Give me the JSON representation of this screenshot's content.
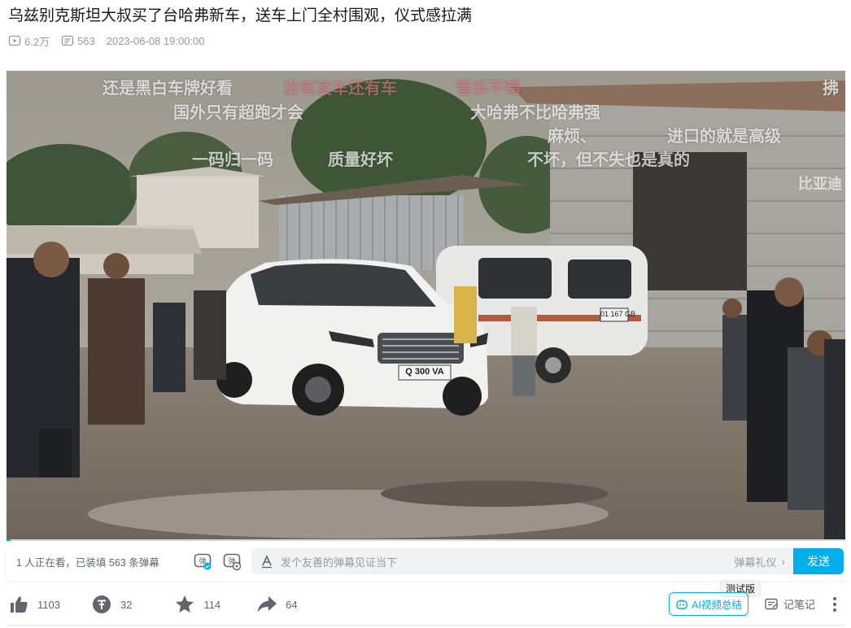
{
  "video": {
    "title": "乌兹别克斯坦大叔买了台哈弗新车，送车上门全村围观，仪式感拉满",
    "views": "6.2万",
    "danmaku_count": "563",
    "publish_time": "2023-06-08 19:00:00",
    "progress_fraction": 0.005
  },
  "danmaku_overlay": [
    "还是黑白车牌好看",
    "没有凌车还有车",
    "音乐不错",
    "国外只有超跑才会",
    "大哈弗不比哈弗强",
    "麻烦、",
    "进口的就是高级",
    "一码归一码",
    "质量好坏",
    "不坏，但不失也是真的",
    "比亚迪",
    "拂"
  ],
  "scene": {
    "license_plate": "Q 300 VA",
    "van_plate": "01 167 GB"
  },
  "danmaku_bar": {
    "watching_text": "1 人正在看，已装填 563 条弹幕",
    "input_placeholder": "发个友善的弹幕见证当下",
    "etiquette_label": "弹幕礼仪",
    "send_label": "发送"
  },
  "toolbar": {
    "like_count": "1103",
    "coin_count": "32",
    "favorite_count": "114",
    "share_count": "64",
    "ai_summary_label": "AI视频总结",
    "ai_tooltip": "测试版",
    "note_label": "记笔记"
  },
  "colors": {
    "accent": "#00aeec",
    "text_primary": "#18191c",
    "text_secondary": "#61666d",
    "text_muted": "#9499a0"
  }
}
